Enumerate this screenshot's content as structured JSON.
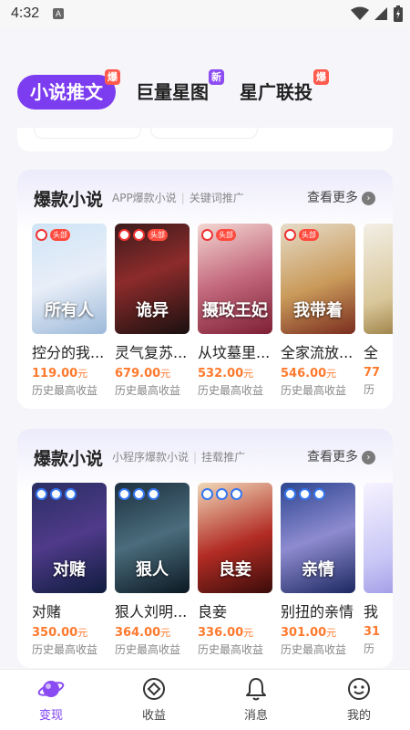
{
  "status_bar": {
    "time": "4:32",
    "app_icon_letter": "A"
  },
  "top_tabs": [
    {
      "label": "小说推文",
      "badge": "爆",
      "active": true
    },
    {
      "label": "巨量星图",
      "badge": "新",
      "active": false
    },
    {
      "label": "星广联投",
      "badge": "爆",
      "active": false
    }
  ],
  "sections": [
    {
      "title": "爆款小说",
      "subtitle_1": "APP爆款小说",
      "subtitle_2": "关键词推广",
      "more_label": "查看更多",
      "books": [
        {
          "name": "控分的我...",
          "price": "119.00",
          "unit": "元",
          "caption": "历史最高收益",
          "cover_title": "所有人",
          "cover_tag": "头部"
        },
        {
          "name": "灵气复苏...",
          "price": "679.00",
          "unit": "元",
          "caption": "历史最高收益",
          "cover_title": "诡异",
          "cover_tag": "头部"
        },
        {
          "name": "从坟墓里...",
          "price": "532.00",
          "unit": "元",
          "caption": "历史最高收益",
          "cover_title": "摄政王妃",
          "cover_tag": "头部"
        },
        {
          "name": "全家流放...",
          "price": "546.00",
          "unit": "元",
          "caption": "历史最高收益",
          "cover_title": "我带着",
          "cover_tag": "头部"
        },
        {
          "name": "全",
          "price": "77",
          "unit": "",
          "caption": "历",
          "cover_title": "",
          "cover_tag": ""
        }
      ]
    },
    {
      "title": "爆款小说",
      "subtitle_1": "小程序爆款小说",
      "subtitle_2": "挂载推广",
      "more_label": "查看更多",
      "books": [
        {
          "name": "对赌",
          "price": "350.00",
          "unit": "元",
          "caption": "历史最高收益",
          "cover_title": "对赌",
          "cover_tag": ""
        },
        {
          "name": "狠人刘明...",
          "price": "364.00",
          "unit": "元",
          "caption": "历史最高收益",
          "cover_title": "狠人",
          "cover_tag": ""
        },
        {
          "name": "良妾",
          "price": "336.00",
          "unit": "元",
          "caption": "历史最高收益",
          "cover_title": "良妾",
          "cover_tag": ""
        },
        {
          "name": "别扭的亲情",
          "price": "301.00",
          "unit": "元",
          "caption": "历史最高收益",
          "cover_title": "亲情",
          "cover_tag": ""
        },
        {
          "name": "我",
          "price": "31",
          "unit": "",
          "caption": "历",
          "cover_title": "",
          "cover_tag": ""
        }
      ]
    }
  ],
  "bottom_nav": [
    {
      "label": "变现",
      "icon": "planet-icon",
      "active": true
    },
    {
      "label": "收益",
      "icon": "coin-icon",
      "active": false
    },
    {
      "label": "消息",
      "icon": "bell-icon",
      "active": false
    },
    {
      "label": "我的",
      "icon": "smiley-icon",
      "active": false
    }
  ],
  "colors": {
    "accent": "#7c3cf0",
    "price": "#ff7a2e",
    "hot_badge": "#ff5a4d",
    "new_badge": "#8d4df3"
  }
}
